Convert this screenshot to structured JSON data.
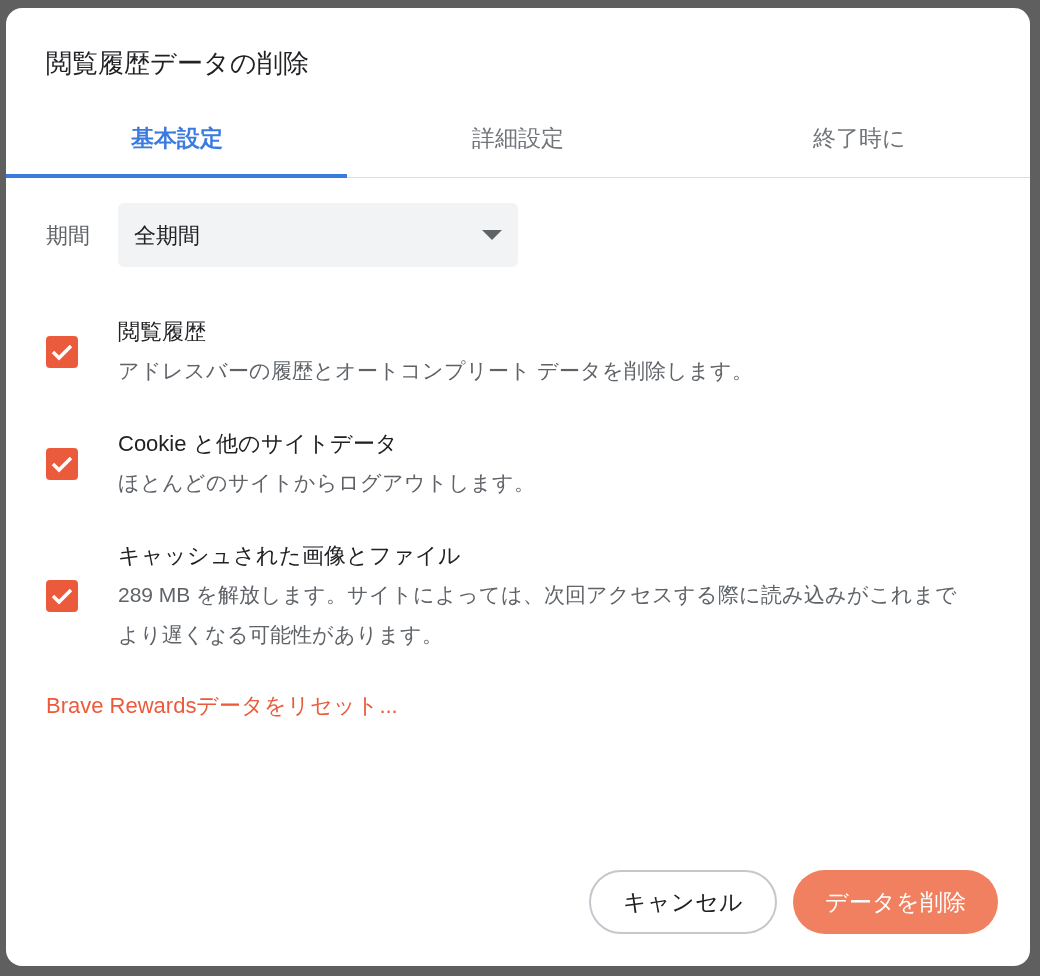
{
  "dialog": {
    "title": "閲覧履歴データの削除",
    "tabs": [
      {
        "label": "基本設定",
        "selected": true
      },
      {
        "label": "詳細設定",
        "selected": false
      },
      {
        "label": "終了時に",
        "selected": false
      }
    ],
    "period": {
      "label": "期間",
      "value": "全期間"
    },
    "items": [
      {
        "title": "閲覧履歴",
        "description": "アドレスバーの履歴とオートコンプリート データを削除します。",
        "checked": true
      },
      {
        "title": "Cookie と他のサイトデータ",
        "description": "ほとんどのサイトからログアウトします。",
        "checked": true
      },
      {
        "title": "キャッシュされた画像とファイル",
        "description": "289 MB を解放します。サイトによっては、次回アクセスする際に読み込みがこれまでより遅くなる可能性があります。",
        "checked": true
      }
    ],
    "link": "Brave Rewardsデータをリセット...",
    "buttons": [
      {
        "label": "キャンセル",
        "kind": "secondary"
      },
      {
        "label": "データを削除",
        "kind": "primary"
      }
    ]
  }
}
